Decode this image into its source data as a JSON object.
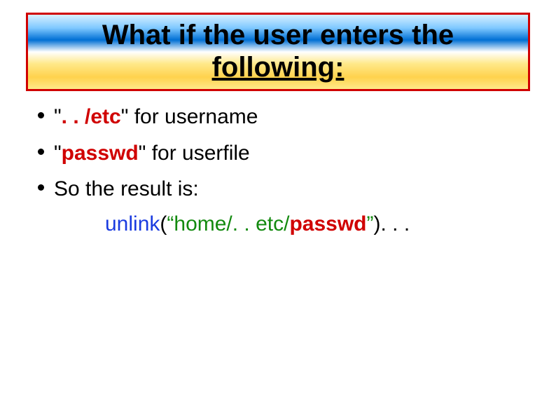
{
  "title": {
    "line1": "What if the user enters the",
    "line2": "following:"
  },
  "bullets": {
    "item1": {
      "prefix": "\"",
      "highlight": ". . /etc",
      "suffix": "\" for username"
    },
    "item2": {
      "prefix": "\"",
      "highlight": "passwd",
      "suffix": "\" for userfile"
    },
    "item3": {
      "text": "So the result is:"
    }
  },
  "subline": {
    "func": "unlink",
    "open_paren": "(",
    "arg_prefix": "“home/. . etc/",
    "arg_highlight": "passwd",
    "arg_suffix": "”",
    "close_paren": "). . ."
  }
}
